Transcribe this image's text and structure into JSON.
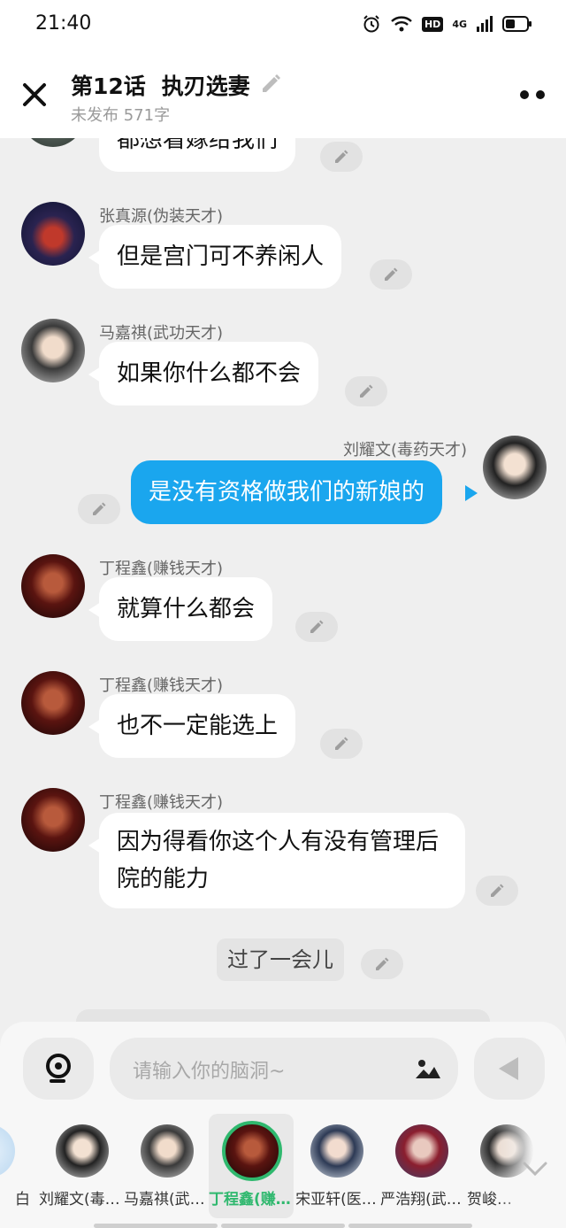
{
  "status": {
    "time": "21:40",
    "hd": "HD",
    "net": "4G"
  },
  "header": {
    "title_num": "第12话",
    "title_name": "执刃选妻",
    "subtitle": "未发布 571字"
  },
  "messages": [
    {
      "type": "in",
      "text": "都想看嫁给我们",
      "clipped": true
    },
    {
      "type": "in",
      "sender": "张真源(伪装天才)",
      "text": "但是宫门可不养闲人"
    },
    {
      "type": "in",
      "sender": "马嘉祺(武功天才)",
      "text": "如果你什么都不会"
    },
    {
      "type": "out",
      "sender": "刘耀文(毒药天才)",
      "text": "是没有资格做我们的新娘的"
    },
    {
      "type": "in",
      "sender": "丁程鑫(赚钱天才)",
      "text": "就算什么都会"
    },
    {
      "type": "in",
      "sender": "丁程鑫(赚钱天才)",
      "text": "也不一定能选上"
    },
    {
      "type": "in",
      "sender": "丁程鑫(赚钱天才)",
      "text": "因为得看你这个人有没有管理后院的能力"
    },
    {
      "type": "narration",
      "text": "过了一会儿"
    }
  ],
  "input": {
    "placeholder": "请输入你的脑洞~"
  },
  "characters": [
    {
      "label": "白",
      "selected": false
    },
    {
      "label": "刘耀文(毒药天才)",
      "selected": false
    },
    {
      "label": "马嘉祺(武功天才)",
      "selected": false
    },
    {
      "label": "丁程鑫(赚钱天才)",
      "selected": true
    },
    {
      "label": "宋亚轩(医…",
      "selected": false
    },
    {
      "label": "严浩翔(武…",
      "selected": false
    },
    {
      "label": "贺峻…",
      "selected": false
    }
  ],
  "colors": {
    "outgoing_bubble": "#1aa6ee",
    "selected_character": "#2fb86e",
    "background": "#efefef"
  },
  "icons": [
    "close-icon",
    "pencil-icon",
    "more-icon",
    "mind-icon",
    "image-icon",
    "send-icon",
    "chevron-down-icon"
  ]
}
